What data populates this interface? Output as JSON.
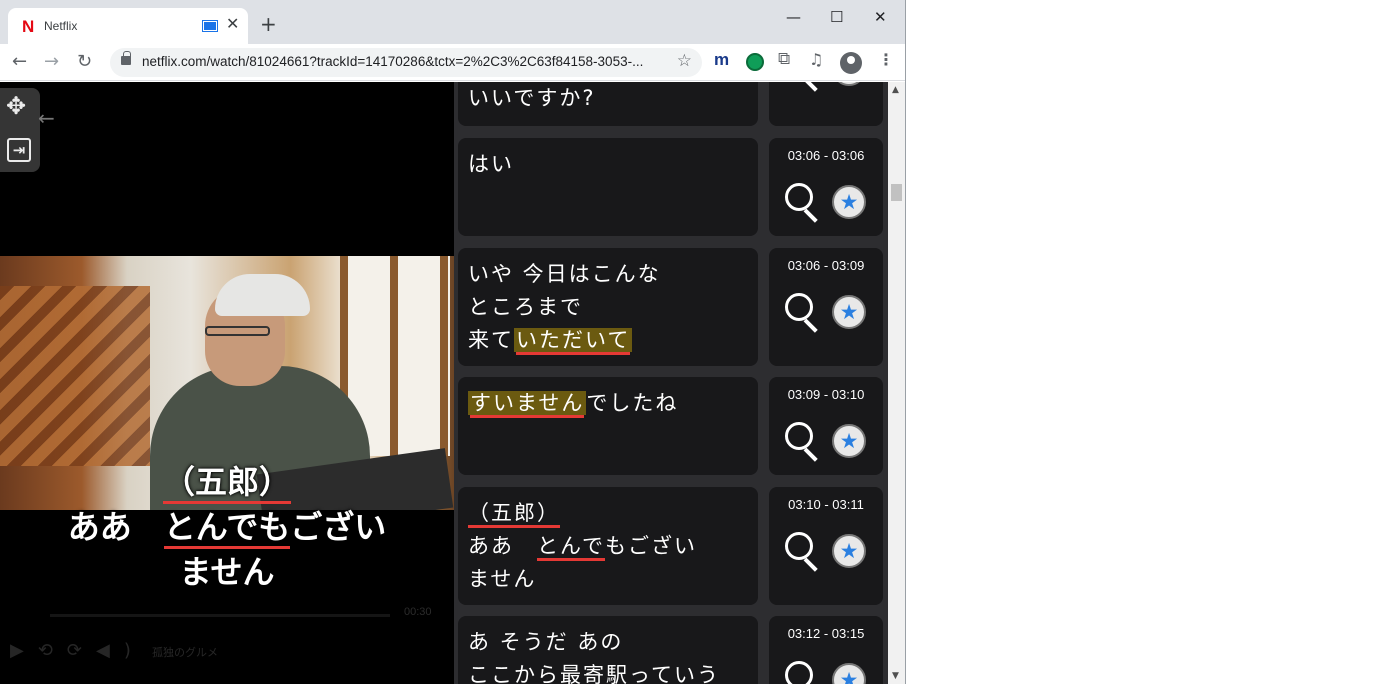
{
  "browser": {
    "tab_title": "Netflix",
    "tab_favicon": "N",
    "url": "netflix.com/watch/81024661?trackId=14170286&tctx=2%2C3%2C63f84158-3053-...",
    "icons": [
      "back-icon",
      "forward-icon",
      "reload-icon",
      "lock-icon",
      "star-icon",
      "puzzle-icon",
      "media-icon",
      "profile-icon",
      "menu-icon"
    ]
  },
  "video": {
    "subtitle_line1": "（五郎）",
    "subtitle_line2_a": "ああ　",
    "subtitle_line2_b": "とんでも",
    "subtitle_line2_c": "ござい",
    "subtitle_line3": "ません"
  },
  "panel": {
    "cards": [
      {
        "time": "",
        "lines": [
          "いいですか?"
        ]
      },
      {
        "time": "03:06 - 03:06",
        "lines": [
          "はい"
        ]
      },
      {
        "time": "03:06 - 03:09",
        "line1": "いや 今日はこんな",
        "line2": "ところまで",
        "line3_a": "来て",
        "line3_b": "いただいて"
      },
      {
        "time": "03:09 - 03:10",
        "line1_a": "すいません",
        "line1_b": "でしたね"
      },
      {
        "time": "03:10 - 03:11",
        "line1": "（五郎）",
        "line2_a": "ああ　",
        "line2_b": "とんで",
        "line2_c": "もござい",
        "line3": "ません"
      },
      {
        "time": "03:12 - 03:15",
        "line1": "あ そうだ あの",
        "line2": "ここから最寄駅っていう"
      }
    ]
  }
}
